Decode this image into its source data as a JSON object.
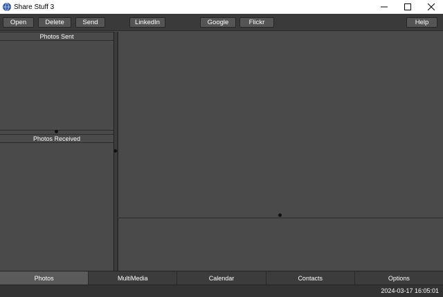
{
  "window": {
    "title": "Share Stuff 3"
  },
  "toolbar": {
    "open": "Open",
    "delete": "Delete",
    "send": "Send",
    "linkedin": "LinkedIn",
    "google": "Google",
    "flickr": "Flickr",
    "help": "Help"
  },
  "left_panel": {
    "sent_header": "Photos Sent",
    "received_header": "Photos Received"
  },
  "tabs": [
    {
      "label": "Photos",
      "active": true
    },
    {
      "label": "MultiMedia",
      "active": false
    },
    {
      "label": "Calendar",
      "active": false
    },
    {
      "label": "Contacts",
      "active": false
    },
    {
      "label": "Options",
      "active": false
    }
  ],
  "status": {
    "timestamp": "2024-03-17 16:05:01"
  },
  "icons": {
    "app": "globe-icon",
    "minimize": "minimize-icon",
    "maximize": "maximize-icon",
    "close": "close-icon"
  },
  "colors": {
    "background": "#4a4a4a",
    "toolbar": "#3a3a3a",
    "button": "#555555",
    "active_tab": "#5a5a5a"
  }
}
